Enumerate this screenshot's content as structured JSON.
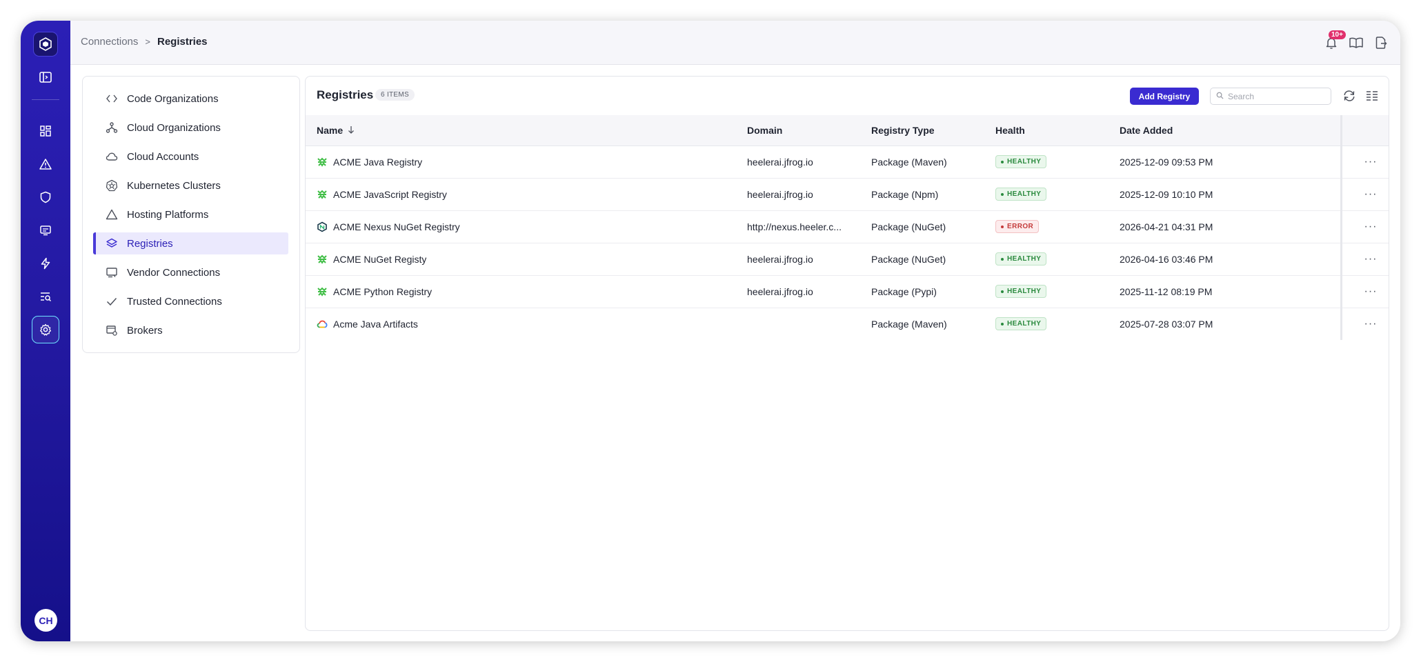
{
  "breadcrumb": {
    "parent": "Connections",
    "current": "Registries"
  },
  "notifications": {
    "badge": "10+"
  },
  "user": {
    "initials": "CH"
  },
  "colors": {
    "accent": "#3a2bd1",
    "rail": "#2b1fb6",
    "healthy": "#2a8a3e",
    "error": "#c43a3a"
  },
  "subnav": {
    "items": [
      {
        "label": "Code Organizations",
        "icon": "code-icon"
      },
      {
        "label": "Cloud Organizations",
        "icon": "hierarchy-icon"
      },
      {
        "label": "Cloud Accounts",
        "icon": "cloud-icon"
      },
      {
        "label": "Kubernetes Clusters",
        "icon": "kubernetes-icon"
      },
      {
        "label": "Hosting Platforms",
        "icon": "triangle-icon"
      },
      {
        "label": "Registries",
        "icon": "layers-icon",
        "active": true
      },
      {
        "label": "Vendor Connections",
        "icon": "monitor-icon"
      },
      {
        "label": "Trusted Connections",
        "icon": "check-icon"
      },
      {
        "label": "Brokers",
        "icon": "broker-icon"
      }
    ]
  },
  "main": {
    "title": "Registries",
    "count": "6 ITEMS",
    "add_label": "Add Registry",
    "search_placeholder": "Search"
  },
  "table": {
    "columns": {
      "name": "Name",
      "domain": "Domain",
      "type": "Registry Type",
      "health": "Health",
      "date": "Date Added"
    },
    "rows": [
      {
        "name": "ACME Java Registry",
        "domain": "heelerai.jfrog.io",
        "type": "Package (Maven)",
        "health": "HEALTHY",
        "date": "2025-12-09 09:53 PM",
        "logo": "jfrog-icon"
      },
      {
        "name": "ACME JavaScript Registry",
        "domain": "heelerai.jfrog.io",
        "type": "Package (Npm)",
        "health": "HEALTHY",
        "date": "2025-12-09 10:10 PM",
        "logo": "jfrog-icon"
      },
      {
        "name": "ACME Nexus NuGet Registry",
        "domain": "http://nexus.heeler.c...",
        "type": "Package (NuGet)",
        "health": "ERROR",
        "date": "2026-04-21 04:31 PM",
        "logo": "nexus-icon"
      },
      {
        "name": "ACME NuGet Registy",
        "domain": "heelerai.jfrog.io",
        "type": "Package (NuGet)",
        "health": "HEALTHY",
        "date": "2026-04-16 03:46 PM",
        "logo": "jfrog-icon"
      },
      {
        "name": "ACME Python Registry",
        "domain": "heelerai.jfrog.io",
        "type": "Package (Pypi)",
        "health": "HEALTHY",
        "date": "2025-11-12 08:19 PM",
        "logo": "jfrog-icon"
      },
      {
        "name": "Acme Java Artifacts",
        "domain": "",
        "type": "Package (Maven)",
        "health": "HEALTHY",
        "date": "2025-07-28 03:07 PM",
        "logo": "google-cloud-icon"
      }
    ]
  }
}
